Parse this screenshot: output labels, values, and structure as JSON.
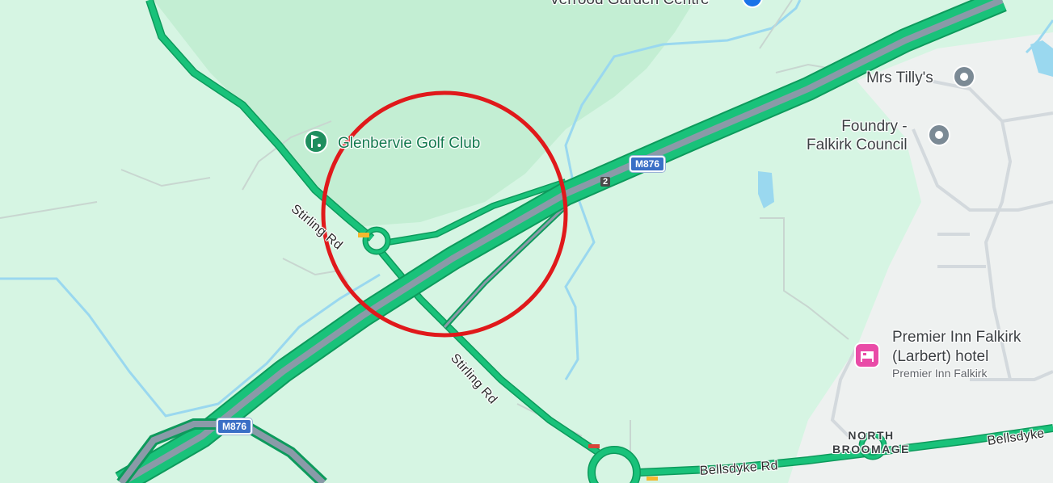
{
  "map": {
    "top_label_partial": "Verrood Garden Centre",
    "pois": {
      "golf": {
        "name": "Glenbervie Golf Club",
        "icon": "golf-icon"
      },
      "mrs_tilly": {
        "name": "Mrs Tilly's",
        "icon": "pin-icon"
      },
      "foundry": {
        "line1": "Foundry -",
        "line2": "Falkirk Council",
        "icon": "pin-icon"
      },
      "hotel": {
        "line1": "Premier Inn Falkirk",
        "line2": "(Larbert) hotel",
        "sub": "Premier Inn Falkirk",
        "icon": "hotel-icon"
      }
    },
    "roads": {
      "stirling_rd_1": "Stirling Rd",
      "stirling_rd_2": "Stirling Rd",
      "bellsdyke_rd_1": "Bellsdyke Rd",
      "bellsdyke_rd_2": "Bellsdyke"
    },
    "shields": {
      "m876_top": "M876",
      "m876_bottom": "M876",
      "junction": "2"
    },
    "area": {
      "line1": "NORTH",
      "line2": "BROOMAGE"
    },
    "colors": {
      "background": "#d6f5e3",
      "park": "#c3eed3",
      "urban": "#eef1f0",
      "water": "#9ad8ef",
      "traffic_green": "#19c27a",
      "motorway_core": "#8a9aa8",
      "highlight_circle": "#e0191b"
    }
  }
}
